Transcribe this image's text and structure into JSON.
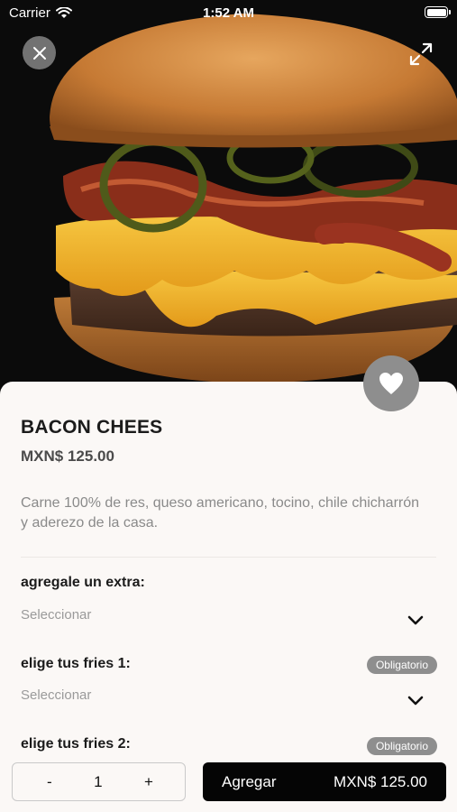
{
  "status_bar": {
    "carrier": "Carrier",
    "time": "1:52 AM",
    "wifi_icon": "wifi-icon",
    "battery_icon": "battery-icon"
  },
  "hero": {
    "close_icon": "close-icon",
    "expand_icon": "expand-icon"
  },
  "product": {
    "name": "BACON CHEES",
    "price": "MXN$ 125.00",
    "description": "Carne 100% de res, queso americano, tocino, chile chicharrón y aderezo de la casa.",
    "favorite_icon": "heart-icon"
  },
  "options": [
    {
      "label": "agregale un extra:",
      "placeholder": "Seleccionar",
      "badge": ""
    },
    {
      "label": "elige tus fries 1:",
      "placeholder": "Seleccionar",
      "badge": "Obligatorio"
    },
    {
      "label": "elige tus fries 2:",
      "placeholder": "",
      "badge": "Obligatorio"
    }
  ],
  "quantity": {
    "minus": "-",
    "value": "1",
    "plus": "+"
  },
  "add_button": {
    "label": "Agregar",
    "price": "MXN$ 125.00"
  },
  "colors": {
    "sheet_bg": "#fbf8f6",
    "button_black": "#050505",
    "badge_gray": "#8e8e8e",
    "cheese": "#f0b52a"
  }
}
